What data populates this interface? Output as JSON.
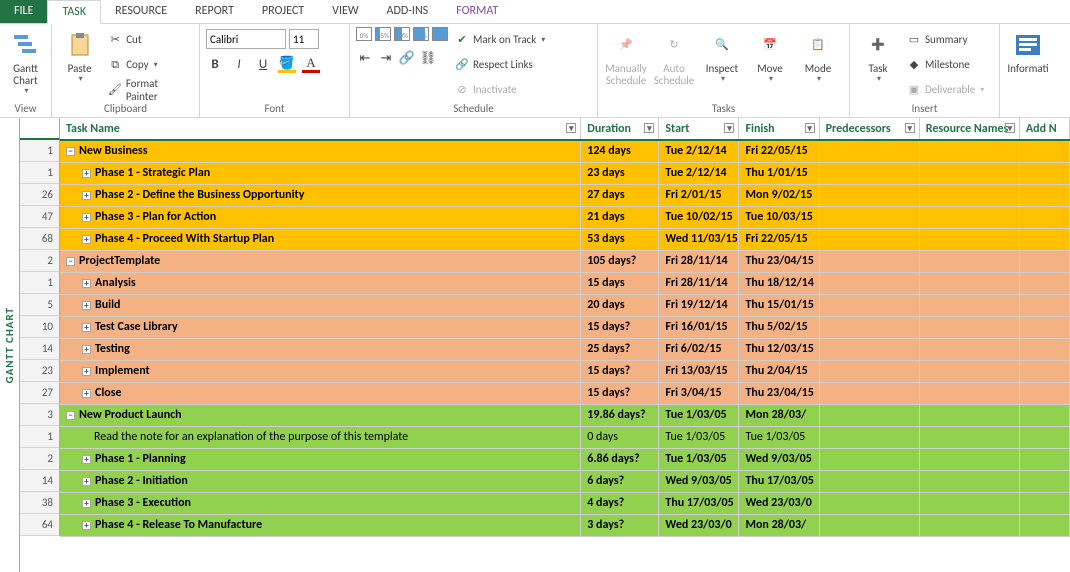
{
  "tabs": {
    "file": "FILE",
    "task": "TASK",
    "resource": "RESOURCE",
    "report": "REPORT",
    "project": "PROJECT",
    "view": "VIEW",
    "addins": "ADD-INS",
    "format": "FORMAT"
  },
  "ribbon": {
    "view": {
      "gantt": "Gantt\nChart",
      "label": "View"
    },
    "clipboard": {
      "paste": "Paste",
      "cut": "Cut",
      "copy": "Copy",
      "fp": "Format Painter",
      "label": "Clipboard"
    },
    "font": {
      "name": "Calibri",
      "size": "11",
      "label": "Font"
    },
    "schedule": {
      "p0": "0%",
      "p25": "25%",
      "p50": "50%",
      "p75": "75%",
      "p100": "100%",
      "mark": "Mark on Track",
      "respect": "Respect Links",
      "inactivate": "Inactivate",
      "label": "Schedule"
    },
    "tasks": {
      "manual": "Manually\nSchedule",
      "auto": "Auto\nSchedule",
      "inspect": "Inspect",
      "move": "Move",
      "mode": "Mode",
      "label": "Tasks"
    },
    "insert": {
      "task": "Task",
      "summary": "Summary",
      "milestone": "Milestone",
      "deliverable": "Deliverable",
      "label": "Insert"
    },
    "info": {
      "info": "Informati",
      "label": ""
    }
  },
  "sidebar": "GANTT CHART",
  "columns": {
    "name": "Task Name",
    "duration": "Duration",
    "start": "Start",
    "finish": "Finish",
    "pred": "Predecessors",
    "res": "Resource Names",
    "add": "Add N"
  },
  "rows": [
    {
      "n": "1",
      "cls": "yellow",
      "ind": 0,
      "ico": "◢",
      "name": "New Business",
      "dur": "124 days",
      "start": "Tue 2/12/14",
      "finish": "Fri 22/05/15"
    },
    {
      "n": "1",
      "cls": "yellow2",
      "ind": 1,
      "ico": "▸",
      "name": "Phase 1 - Strategic Plan",
      "dur": "23 days",
      "start": "Tue 2/12/14",
      "finish": "Thu 1/01/15"
    },
    {
      "n": "26",
      "cls": "yellow2",
      "ind": 1,
      "ico": "▸",
      "name": "Phase 2 - Define the Business Opportunity",
      "dur": "27 days",
      "start": "Fri 2/01/15",
      "finish": "Mon 9/02/15"
    },
    {
      "n": "47",
      "cls": "yellow2",
      "ind": 1,
      "ico": "▸",
      "name": "Phase 3 - Plan for Action",
      "dur": "21 days",
      "start": "Tue 10/02/15",
      "finish": "Tue 10/03/15"
    },
    {
      "n": "68",
      "cls": "yellow2",
      "ind": 1,
      "ico": "▸",
      "name": "Phase 4 - Proceed With Startup Plan",
      "dur": "53 days",
      "start": "Wed 11/03/15",
      "finish": "Fri 22/05/15"
    },
    {
      "n": "2",
      "cls": "orange",
      "ind": 0,
      "ico": "◢",
      "name": "ProjectTemplate",
      "dur": "105 days?",
      "start": "Fri 28/11/14",
      "finish": "Thu 23/04/15"
    },
    {
      "n": "1",
      "cls": "orange",
      "ind": 1,
      "ico": "▸",
      "name": "Analysis",
      "dur": "15 days",
      "start": "Fri 28/11/14",
      "finish": "Thu 18/12/14"
    },
    {
      "n": "5",
      "cls": "orange",
      "ind": 1,
      "ico": "▸",
      "name": "Build",
      "dur": "20 days",
      "start": "Fri 19/12/14",
      "finish": "Thu 15/01/15"
    },
    {
      "n": "10",
      "cls": "orange",
      "ind": 1,
      "ico": "▸",
      "name": "Test Case Library",
      "dur": "15 days?",
      "start": "Fri 16/01/15",
      "finish": "Thu 5/02/15"
    },
    {
      "n": "14",
      "cls": "orange",
      "ind": 1,
      "ico": "▸",
      "name": "Testing",
      "dur": "25 days?",
      "start": "Fri 6/02/15",
      "finish": "Thu 12/03/15"
    },
    {
      "n": "23",
      "cls": "orange",
      "ind": 1,
      "ico": "▸",
      "name": "Implement",
      "dur": "15 days?",
      "start": "Fri 13/03/15",
      "finish": "Thu 2/04/15"
    },
    {
      "n": "27",
      "cls": "orange",
      "ind": 1,
      "ico": "▸",
      "name": "Close",
      "dur": "15 days?",
      "start": "Fri 3/04/15",
      "finish": "Thu 23/04/15"
    },
    {
      "n": "3",
      "cls": "green",
      "ind": 0,
      "ico": "◢",
      "name": "New Product Launch",
      "dur": "19.86 days?",
      "start": "Tue 1/03/05",
      "finish": "Mon 28/03/"
    },
    {
      "n": "1",
      "cls": "greenplain",
      "ind": 2,
      "ico": "",
      "name": "Read the note for an explanation of the purpose of this template",
      "dur": "0 days",
      "start": "Tue 1/03/05",
      "finish": "Tue 1/03/05"
    },
    {
      "n": "2",
      "cls": "green",
      "ind": 1,
      "ico": "▸",
      "name": "Phase 1 - Planning",
      "dur": "6.86 days?",
      "start": "Tue 1/03/05",
      "finish": "Wed 9/03/05"
    },
    {
      "n": "14",
      "cls": "green",
      "ind": 1,
      "ico": "▸",
      "name": "Phase 2 - Initiation",
      "dur": "6 days?",
      "start": "Wed 9/03/05",
      "finish": "Thu 17/03/05"
    },
    {
      "n": "38",
      "cls": "green",
      "ind": 1,
      "ico": "▸",
      "name": "Phase 3 - Execution",
      "dur": "4 days?",
      "start": "Thu 17/03/05",
      "finish": "Wed 23/03/0"
    },
    {
      "n": "64",
      "cls": "green",
      "ind": 1,
      "ico": "▸",
      "name": "Phase 4 - Release To Manufacture",
      "dur": "3 days?",
      "start": "Wed 23/03/0",
      "finish": "Mon 28/03/"
    }
  ]
}
